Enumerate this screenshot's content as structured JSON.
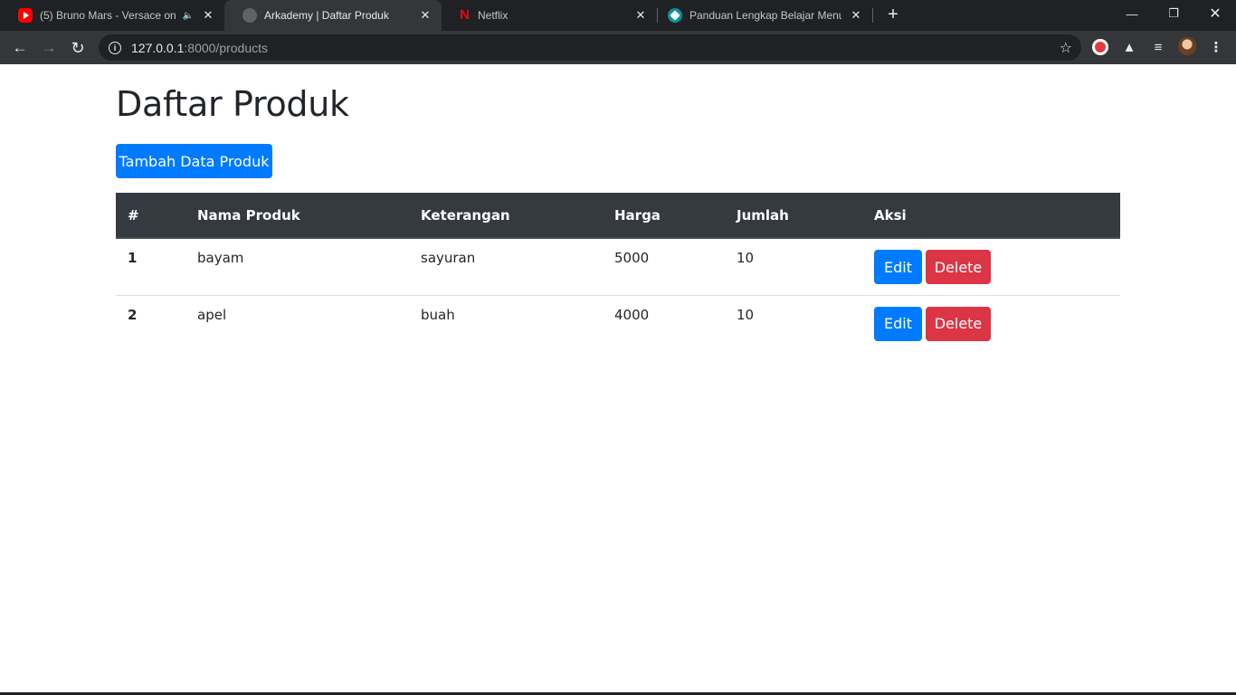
{
  "browser": {
    "tabs": [
      {
        "title": "(5) Bruno Mars - Versace on",
        "favicon": "youtube-icon",
        "audio": true
      },
      {
        "title": "Arkademy | Daftar Produk",
        "favicon": "globe-icon",
        "active": true
      },
      {
        "title": "Netflix",
        "favicon": "netflix-icon"
      },
      {
        "title": "Panduan Lengkap Belajar Menuli",
        "favicon": "site-icon"
      }
    ],
    "url_host": "127.0.0.1",
    "url_rest": ":8000/products"
  },
  "page": {
    "title": "Daftar Produk",
    "add_button": "Tambah Data Produk",
    "table": {
      "headers": [
        "#",
        "Nama Produk",
        "Keterangan",
        "Harga",
        "Jumlah",
        "Aksi"
      ],
      "rows": [
        {
          "no": "1",
          "nama": "bayam",
          "keterangan": "sayuran",
          "harga": "5000",
          "jumlah": "10"
        },
        {
          "no": "2",
          "nama": "apel",
          "keterangan": "buah",
          "harga": "4000",
          "jumlah": "10"
        }
      ],
      "edit_label": "Edit",
      "delete_label": "Delete"
    }
  },
  "colors": {
    "primary": "#007bff",
    "danger": "#dc3545",
    "table_header": "#343a40"
  }
}
